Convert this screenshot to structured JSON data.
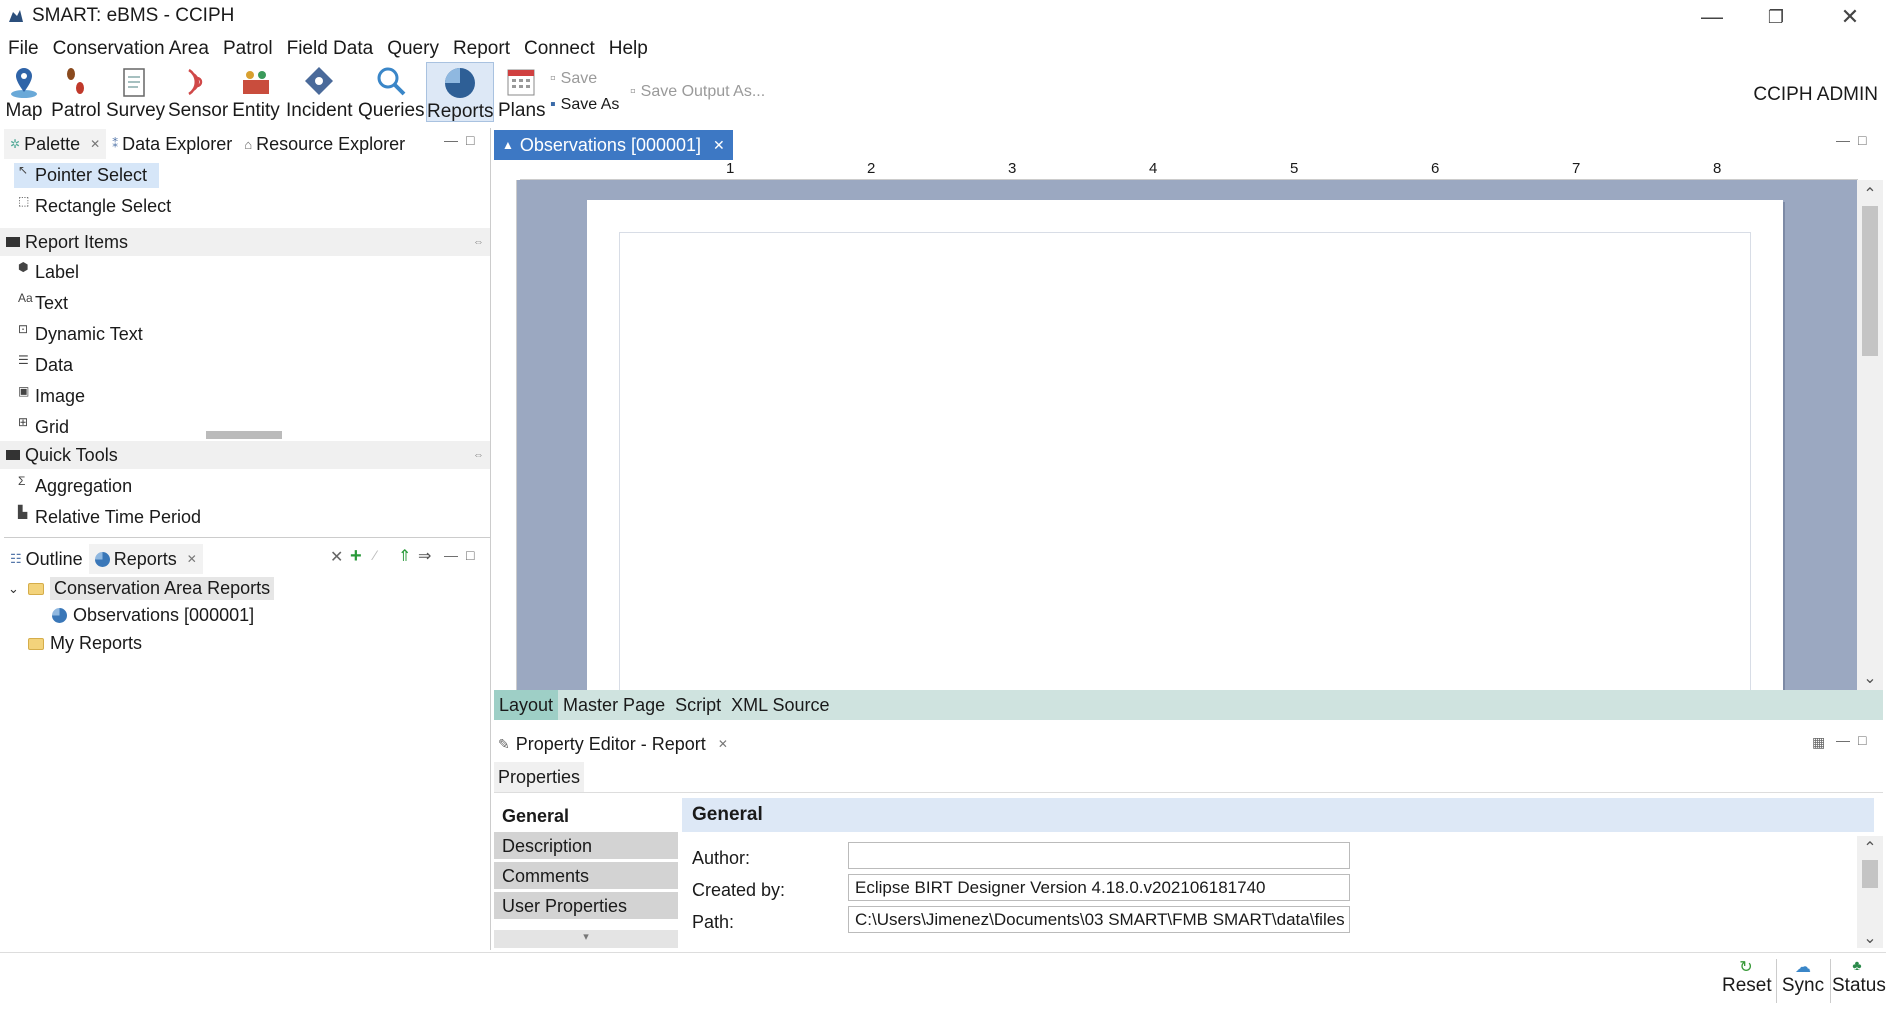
{
  "window": {
    "title": "SMART: eBMS - CCIPH",
    "minimize": "—",
    "restore": "❐",
    "close": "✕"
  },
  "menu": [
    "File",
    "Conservation Area",
    "Patrol",
    "Field Data",
    "Query",
    "Report",
    "Connect",
    "Help"
  ],
  "toolbar": {
    "tools": [
      "Map",
      "Patrol",
      "Survey",
      "Sensor",
      "Entity",
      "Incident",
      "Queries",
      "Reports",
      "Plans"
    ],
    "save": "Save",
    "save_as": "Save As",
    "save_output_as": "Save Output As...",
    "user": "CCIPH ADMIN"
  },
  "palette": {
    "tabs": [
      "Palette",
      "Data Explorer",
      "Resource Explorer"
    ],
    "selection_tools": [
      "Pointer Select",
      "Rectangle Select"
    ],
    "report_items_header": "Report Items",
    "report_items": [
      "Label",
      "Text",
      "Dynamic Text",
      "Data",
      "Image",
      "Grid"
    ],
    "quick_tools_header": "Quick Tools",
    "quick_tools": [
      "Aggregation",
      "Relative Time Period"
    ]
  },
  "outline": {
    "tabs": [
      "Outline",
      "Reports"
    ],
    "tree": {
      "root": "Conservation Area Reports",
      "child": "Observations [000001]",
      "second": "My Reports"
    }
  },
  "editor": {
    "tab": "Observations [000001]",
    "ruler_marks": [
      "1",
      "2",
      "3",
      "4",
      "5",
      "6",
      "7",
      "8"
    ],
    "bottom_tabs": [
      "Layout",
      "Master Page",
      "Script",
      "XML Source"
    ]
  },
  "property_editor": {
    "title": "Property Editor - Report",
    "properties_tab": "Properties",
    "side_tabs": [
      "General",
      "Description",
      "Comments",
      "User Properties"
    ],
    "section_title": "General",
    "fields": [
      {
        "label": "Author:",
        "value": ""
      },
      {
        "label": "Created by:",
        "value": "Eclipse BIRT Designer Version 4.18.0.v202106181740"
      },
      {
        "label": "Path:",
        "value": "C:\\Users\\Jimenez\\Documents\\03 SMART\\FMB SMART\\data\\files"
      }
    ]
  },
  "status": [
    "Reset",
    "Sync",
    "Status"
  ],
  "colors": {
    "accent": "#3d78c4",
    "canvas": "#9ba8c1",
    "layout_tab": "#9ecfc6"
  }
}
